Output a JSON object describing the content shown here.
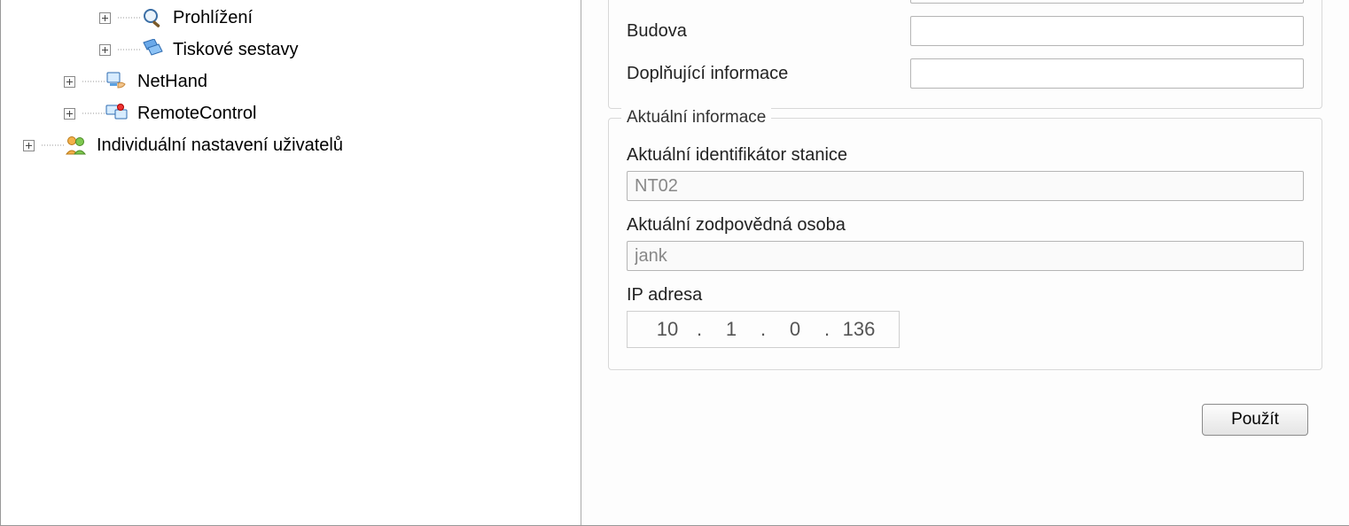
{
  "tree": {
    "items": [
      {
        "label": "Prohlížení",
        "icon": "magnifier"
      },
      {
        "label": "Tiskové sestavy",
        "icon": "reports"
      },
      {
        "label": "NetHand",
        "icon": "nethand"
      },
      {
        "label": "RemoteControl",
        "icon": "remotecontrol"
      },
      {
        "label": "Individuální nastavení uživatelů",
        "icon": "users"
      }
    ]
  },
  "form": {
    "top_field_value": "",
    "budova_label": "Budova",
    "budova_value": "",
    "dopln_label": "Doplňující informace",
    "dopln_value": ""
  },
  "group": {
    "legend": "Aktuální informace",
    "id_label": "Aktuální identifikátor stanice",
    "id_value": "NT02",
    "person_label": "Aktuální zodpovědná osoba",
    "person_value": "jank",
    "ip_label": "IP adresa",
    "ip": {
      "a": "10",
      "b": "1",
      "c": "0",
      "d": "136"
    }
  },
  "buttons": {
    "apply": "Použít"
  }
}
